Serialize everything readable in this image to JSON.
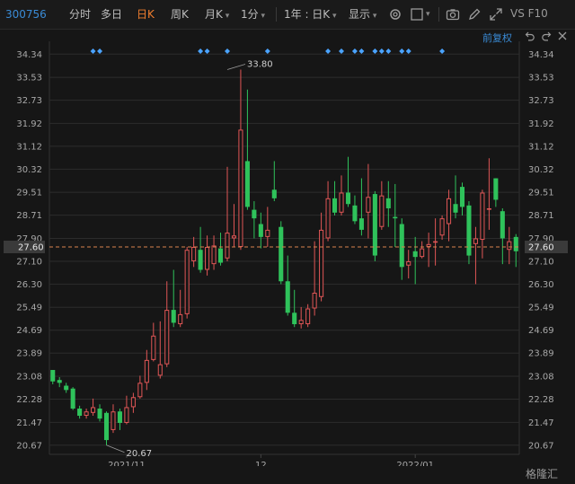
{
  "toolbar": {
    "code": "300756",
    "tabs": [
      "分时",
      "多日",
      "日K",
      "周K",
      "月K",
      "1分"
    ],
    "active_tab": "日K",
    "period_select": "1年 : 日K",
    "display_select": "显示",
    "vs_label": "VS F10",
    "restore_label": "前复权",
    "icons": [
      "settings-gear-icon",
      "checkbox-icon",
      "camera-icon",
      "pen-icon",
      "expand-icon",
      "undo-icon",
      "redo-icon",
      "close-icon"
    ]
  },
  "watermark": "格隆汇",
  "chart_data": {
    "type": "candlestick",
    "y_ticks": [
      "34.34",
      "33.53",
      "32.73",
      "31.92",
      "31.12",
      "30.32",
      "29.51",
      "28.71",
      "27.90",
      "27.10",
      "26.30",
      "25.49",
      "24.69",
      "23.89",
      "23.08",
      "22.28",
      "21.47",
      "20.67"
    ],
    "ylim": [
      20.35,
      34.6
    ],
    "x_labels": [
      {
        "label": "2021/11",
        "index": 11
      },
      {
        "label": "12",
        "index": 31
      },
      {
        "label": "2022/01",
        "index": 54
      }
    ],
    "current_price": "27.60",
    "current_value": 27.6,
    "annotations": [
      {
        "label": "33.80",
        "index": 26,
        "value": 33.8
      },
      {
        "label": "20.67",
        "index": 8,
        "value": 20.67
      }
    ],
    "event_marker_indices": [
      6,
      7,
      22,
      23,
      26,
      32,
      41,
      43,
      45,
      46,
      48,
      49,
      50,
      52,
      53,
      58
    ],
    "colors": {
      "up": "#e05656",
      "down": "#2fc25b",
      "grid": "#2c2c2c",
      "price_line": "#d9824f",
      "marker": "#4aa3ff",
      "axis_text": "#a8a8a8"
    },
    "candles": [
      {
        "o": 23.3,
        "c": 22.9,
        "h": 23.3,
        "l": 22.8
      },
      {
        "o": 22.95,
        "c": 22.85,
        "h": 23.05,
        "l": 22.7
      },
      {
        "o": 22.75,
        "c": 22.6,
        "h": 22.85,
        "l": 22.5
      },
      {
        "o": 22.65,
        "c": 21.95,
        "h": 22.7,
        "l": 21.9
      },
      {
        "o": 21.95,
        "c": 21.7,
        "h": 22.05,
        "l": 21.6
      },
      {
        "o": 21.7,
        "c": 21.85,
        "h": 21.95,
        "l": 21.6
      },
      {
        "o": 21.8,
        "c": 22.0,
        "h": 22.3,
        "l": 21.7
      },
      {
        "o": 21.95,
        "c": 21.6,
        "h": 22.1,
        "l": 21.5
      },
      {
        "o": 21.8,
        "c": 20.85,
        "h": 21.85,
        "l": 20.67
      },
      {
        "o": 21.2,
        "c": 21.85,
        "h": 22.1,
        "l": 21.1
      },
      {
        "o": 21.85,
        "c": 21.45,
        "h": 21.95,
        "l": 21.2
      },
      {
        "o": 21.45,
        "c": 22.0,
        "h": 22.4,
        "l": 21.4
      },
      {
        "o": 22.0,
        "c": 22.35,
        "h": 22.5,
        "l": 21.8
      },
      {
        "o": 22.35,
        "c": 22.85,
        "h": 23.1,
        "l": 22.3
      },
      {
        "o": 22.85,
        "c": 23.65,
        "h": 24.0,
        "l": 22.6
      },
      {
        "o": 23.65,
        "c": 24.5,
        "h": 24.95,
        "l": 23.6
      },
      {
        "o": 23.1,
        "c": 23.5,
        "h": 25.0,
        "l": 23.0
      },
      {
        "o": 23.5,
        "c": 25.4,
        "h": 26.4,
        "l": 23.4
      },
      {
        "o": 25.4,
        "c": 24.95,
        "h": 26.8,
        "l": 24.8
      },
      {
        "o": 24.9,
        "c": 25.25,
        "h": 26.1,
        "l": 24.8
      },
      {
        "o": 25.25,
        "c": 27.5,
        "h": 27.6,
        "l": 25.1
      },
      {
        "o": 27.1,
        "c": 27.6,
        "h": 27.95,
        "l": 26.9
      },
      {
        "o": 27.5,
        "c": 26.8,
        "h": 28.3,
        "l": 26.7
      },
      {
        "o": 26.8,
        "c": 27.6,
        "h": 28.0,
        "l": 26.6
      },
      {
        "o": 27.0,
        "c": 27.65,
        "h": 28.0,
        "l": 26.8
      },
      {
        "o": 27.55,
        "c": 27.05,
        "h": 28.1,
        "l": 26.95
      },
      {
        "o": 27.2,
        "c": 28.1,
        "h": 30.4,
        "l": 27.1
      },
      {
        "o": 27.9,
        "c": 28.0,
        "h": 29.1,
        "l": 27.6
      },
      {
        "o": 27.6,
        "c": 31.7,
        "h": 33.8,
        "l": 27.5
      },
      {
        "o": 30.6,
        "c": 29.0,
        "h": 33.1,
        "l": 28.9
      },
      {
        "o": 28.9,
        "c": 28.6,
        "h": 29.2,
        "l": 27.9
      },
      {
        "o": 28.4,
        "c": 27.95,
        "h": 28.8,
        "l": 27.55
      },
      {
        "o": 27.95,
        "c": 28.2,
        "h": 29.0,
        "l": 27.6
      },
      {
        "o": 29.6,
        "c": 29.3,
        "h": 30.6,
        "l": 29.2
      },
      {
        "o": 28.3,
        "c": 26.4,
        "h": 28.5,
        "l": 26.3
      },
      {
        "o": 26.4,
        "c": 25.3,
        "h": 27.3,
        "l": 25.2
      },
      {
        "o": 25.3,
        "c": 24.9,
        "h": 26.1,
        "l": 24.8
      },
      {
        "o": 24.9,
        "c": 25.05,
        "h": 25.5,
        "l": 24.75
      },
      {
        "o": 24.9,
        "c": 25.45,
        "h": 25.6,
        "l": 24.8
      },
      {
        "o": 25.45,
        "c": 26.0,
        "h": 27.8,
        "l": 25.2
      },
      {
        "o": 25.85,
        "c": 28.2,
        "h": 28.8,
        "l": 25.7
      },
      {
        "o": 27.9,
        "c": 29.3,
        "h": 29.9,
        "l": 27.8
      },
      {
        "o": 29.3,
        "c": 28.8,
        "h": 29.9,
        "l": 28.7
      },
      {
        "o": 28.8,
        "c": 29.5,
        "h": 30.1,
        "l": 28.7
      },
      {
        "o": 29.5,
        "c": 29.1,
        "h": 30.75,
        "l": 29.0
      },
      {
        "o": 29.05,
        "c": 28.5,
        "h": 29.4,
        "l": 28.4
      },
      {
        "o": 28.6,
        "c": 28.2,
        "h": 30.0,
        "l": 28.0
      },
      {
        "o": 28.8,
        "c": 29.35,
        "h": 30.5,
        "l": 27.9
      },
      {
        "o": 29.45,
        "c": 27.3,
        "h": 29.55,
        "l": 27.1
      },
      {
        "o": 28.3,
        "c": 29.4,
        "h": 29.9,
        "l": 28.2
      },
      {
        "o": 29.3,
        "c": 28.95,
        "h": 29.9,
        "l": 28.3
      },
      {
        "o": 28.65,
        "c": 28.6,
        "h": 29.8,
        "l": 27.6
      },
      {
        "o": 28.4,
        "c": 26.9,
        "h": 28.6,
        "l": 26.45
      },
      {
        "o": 26.95,
        "c": 27.1,
        "h": 27.5,
        "l": 26.5
      },
      {
        "o": 27.45,
        "c": 27.25,
        "h": 27.95,
        "l": 26.3
      },
      {
        "o": 27.25,
        "c": 27.55,
        "h": 27.8,
        "l": 27.2
      },
      {
        "o": 27.6,
        "c": 27.7,
        "h": 28.1,
        "l": 26.9
      },
      {
        "o": 27.75,
        "c": 27.8,
        "h": 28.6,
        "l": 26.95
      },
      {
        "o": 28.0,
        "c": 28.6,
        "h": 28.7,
        "l": 27.85
      },
      {
        "o": 28.4,
        "c": 29.3,
        "h": 29.6,
        "l": 27.8
      },
      {
        "o": 29.1,
        "c": 28.8,
        "h": 30.1,
        "l": 28.6
      },
      {
        "o": 29.7,
        "c": 29.0,
        "h": 29.85,
        "l": 28.7
      },
      {
        "o": 29.05,
        "c": 27.3,
        "h": 29.2,
        "l": 27.0
      },
      {
        "o": 27.7,
        "c": 27.9,
        "h": 28.3,
        "l": 26.3
      },
      {
        "o": 27.85,
        "c": 29.5,
        "h": 29.6,
        "l": 27.2
      },
      {
        "o": 28.9,
        "c": 28.95,
        "h": 30.7,
        "l": 28.2
      },
      {
        "o": 30.0,
        "c": 29.25,
        "h": 30.0,
        "l": 29.0
      },
      {
        "o": 28.85,
        "c": 27.9,
        "h": 28.95,
        "l": 27.0
      },
      {
        "o": 27.5,
        "c": 27.8,
        "h": 28.3,
        "l": 27.0
      },
      {
        "o": 27.95,
        "c": 27.45,
        "h": 28.05,
        "l": 26.9
      }
    ]
  }
}
